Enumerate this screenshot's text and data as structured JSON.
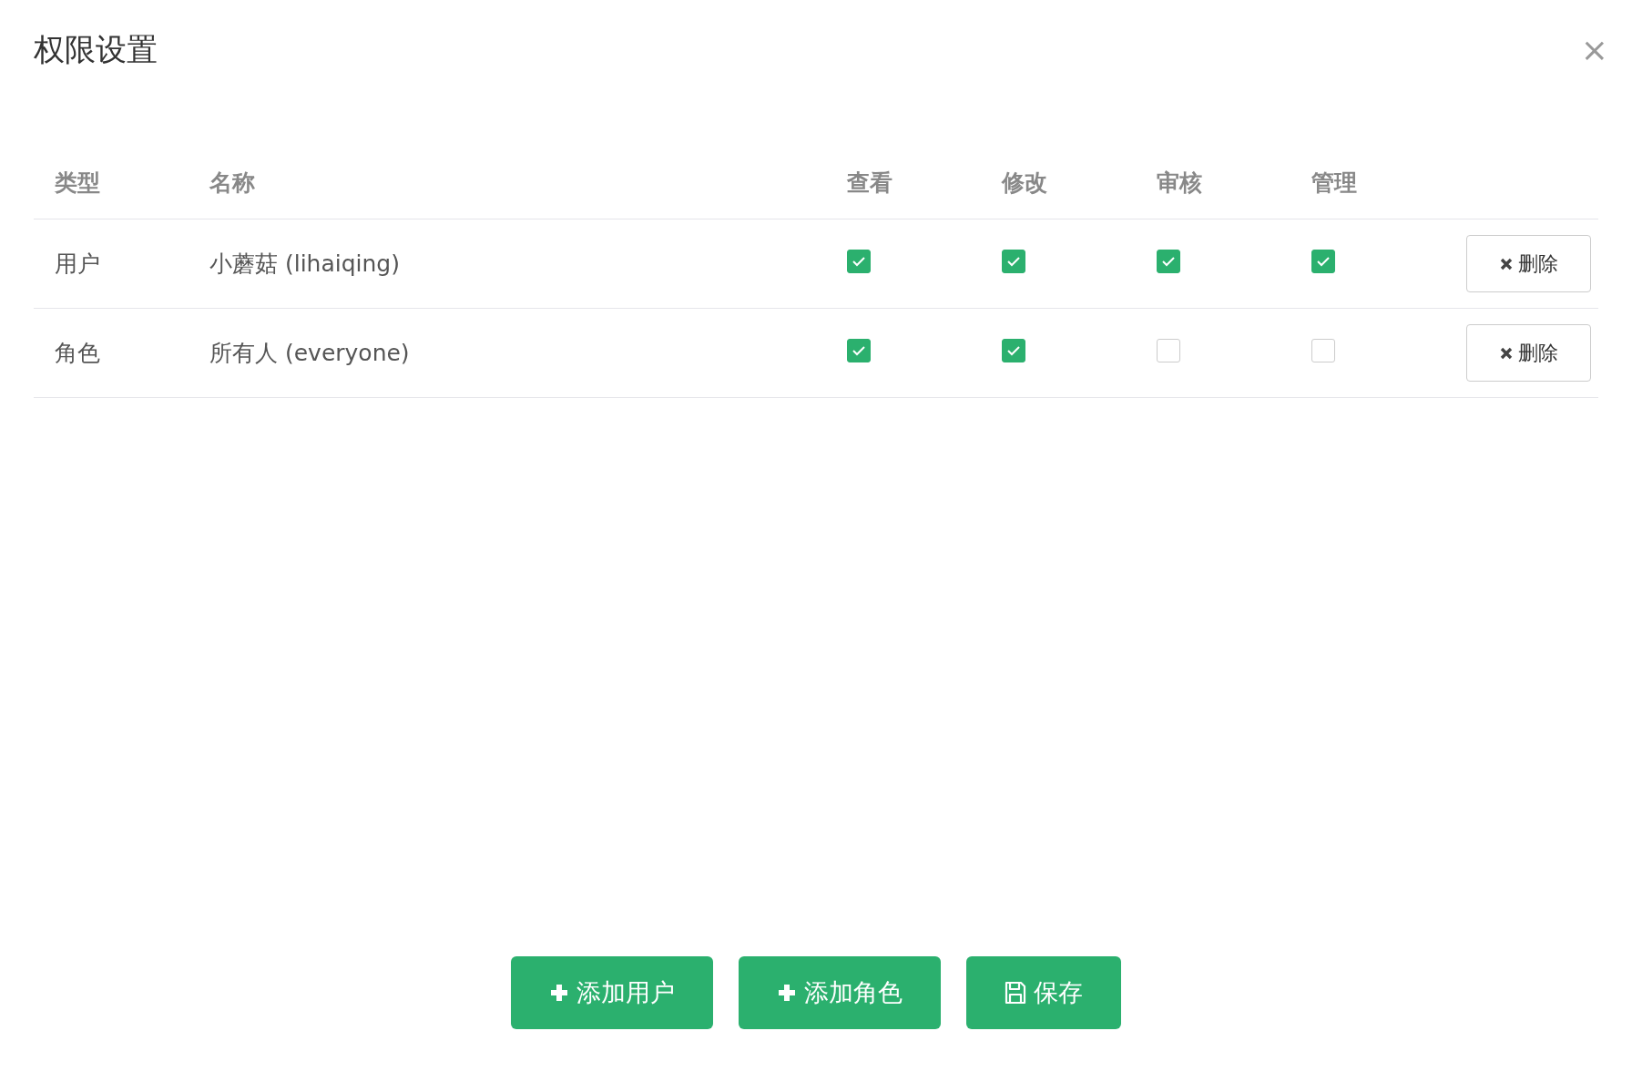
{
  "dialog": {
    "title": "权限设置",
    "close": "×"
  },
  "table": {
    "columns": [
      "类型",
      "名称",
      "查看",
      "修改",
      "审核",
      "管理"
    ],
    "rows": [
      {
        "type": "用户",
        "name": "小蘑菇 (lihaiqing)",
        "permissions": [
          {
            "checked": true
          },
          {
            "checked": true
          },
          {
            "checked": true
          },
          {
            "checked": true
          }
        ],
        "delete_label": "删除"
      },
      {
        "type": "角色",
        "name": "所有人 (everyone)",
        "permissions": [
          {
            "checked": true
          },
          {
            "checked": true
          },
          {
            "checked": false
          },
          {
            "checked": false
          }
        ],
        "delete_label": "删除"
      }
    ]
  },
  "buttons": [
    {
      "kind": "add",
      "label": "添加用户"
    },
    {
      "kind": "add",
      "label": "添加角色"
    },
    {
      "kind": "save",
      "label": "保存"
    }
  ]
}
